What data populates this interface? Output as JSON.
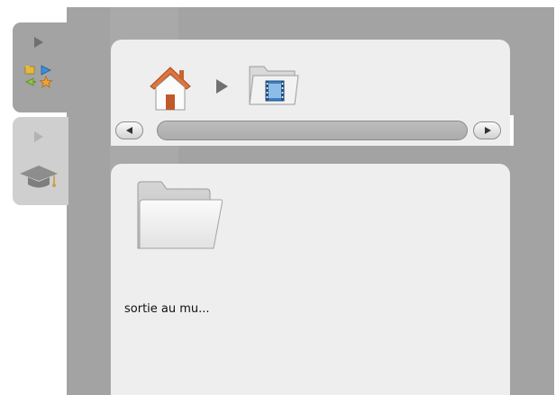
{
  "side_tabs": [
    {
      "name": "tools",
      "icon": "tools-icon",
      "active": true
    },
    {
      "name": "education",
      "icon": "graduation-cap-icon",
      "active": false
    }
  ],
  "breadcrumb": {
    "items": [
      {
        "icon": "home-icon"
      },
      {
        "icon": "movie-folder-icon"
      }
    ],
    "separator_icon": "chevron-right-icon"
  },
  "scrollbar": {
    "left_icon": "scroll-left-icon",
    "right_icon": "scroll-right-icon"
  },
  "content": {
    "items": [
      {
        "label": "sortie au mu...",
        "icon": "folder-icon"
      }
    ]
  },
  "colors": {
    "panel_bg": "#a3a3a3",
    "card_bg": "#eeeeee",
    "inactive_tab": "#cfcfcf"
  }
}
